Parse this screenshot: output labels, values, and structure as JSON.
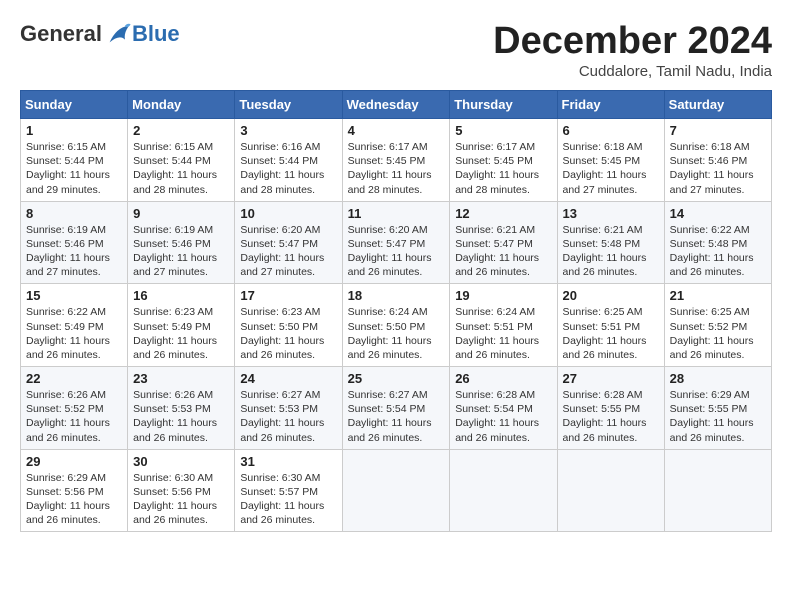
{
  "header": {
    "logo_general": "General",
    "logo_blue": "Blue",
    "month_title": "December 2024",
    "location": "Cuddalore, Tamil Nadu, India"
  },
  "columns": [
    "Sunday",
    "Monday",
    "Tuesday",
    "Wednesday",
    "Thursday",
    "Friday",
    "Saturday"
  ],
  "weeks": [
    [
      {
        "day": "1",
        "sunrise": "6:15 AM",
        "sunset": "5:44 PM",
        "daylight": "11 hours and 29 minutes."
      },
      {
        "day": "2",
        "sunrise": "6:15 AM",
        "sunset": "5:44 PM",
        "daylight": "11 hours and 28 minutes."
      },
      {
        "day": "3",
        "sunrise": "6:16 AM",
        "sunset": "5:44 PM",
        "daylight": "11 hours and 28 minutes."
      },
      {
        "day": "4",
        "sunrise": "6:17 AM",
        "sunset": "5:45 PM",
        "daylight": "11 hours and 28 minutes."
      },
      {
        "day": "5",
        "sunrise": "6:17 AM",
        "sunset": "5:45 PM",
        "daylight": "11 hours and 28 minutes."
      },
      {
        "day": "6",
        "sunrise": "6:18 AM",
        "sunset": "5:45 PM",
        "daylight": "11 hours and 27 minutes."
      },
      {
        "day": "7",
        "sunrise": "6:18 AM",
        "sunset": "5:46 PM",
        "daylight": "11 hours and 27 minutes."
      }
    ],
    [
      {
        "day": "8",
        "sunrise": "6:19 AM",
        "sunset": "5:46 PM",
        "daylight": "11 hours and 27 minutes."
      },
      {
        "day": "9",
        "sunrise": "6:19 AM",
        "sunset": "5:46 PM",
        "daylight": "11 hours and 27 minutes."
      },
      {
        "day": "10",
        "sunrise": "6:20 AM",
        "sunset": "5:47 PM",
        "daylight": "11 hours and 27 minutes."
      },
      {
        "day": "11",
        "sunrise": "6:20 AM",
        "sunset": "5:47 PM",
        "daylight": "11 hours and 26 minutes."
      },
      {
        "day": "12",
        "sunrise": "6:21 AM",
        "sunset": "5:47 PM",
        "daylight": "11 hours and 26 minutes."
      },
      {
        "day": "13",
        "sunrise": "6:21 AM",
        "sunset": "5:48 PM",
        "daylight": "11 hours and 26 minutes."
      },
      {
        "day": "14",
        "sunrise": "6:22 AM",
        "sunset": "5:48 PM",
        "daylight": "11 hours and 26 minutes."
      }
    ],
    [
      {
        "day": "15",
        "sunrise": "6:22 AM",
        "sunset": "5:49 PM",
        "daylight": "11 hours and 26 minutes."
      },
      {
        "day": "16",
        "sunrise": "6:23 AM",
        "sunset": "5:49 PM",
        "daylight": "11 hours and 26 minutes."
      },
      {
        "day": "17",
        "sunrise": "6:23 AM",
        "sunset": "5:50 PM",
        "daylight": "11 hours and 26 minutes."
      },
      {
        "day": "18",
        "sunrise": "6:24 AM",
        "sunset": "5:50 PM",
        "daylight": "11 hours and 26 minutes."
      },
      {
        "day": "19",
        "sunrise": "6:24 AM",
        "sunset": "5:51 PM",
        "daylight": "11 hours and 26 minutes."
      },
      {
        "day": "20",
        "sunrise": "6:25 AM",
        "sunset": "5:51 PM",
        "daylight": "11 hours and 26 minutes."
      },
      {
        "day": "21",
        "sunrise": "6:25 AM",
        "sunset": "5:52 PM",
        "daylight": "11 hours and 26 minutes."
      }
    ],
    [
      {
        "day": "22",
        "sunrise": "6:26 AM",
        "sunset": "5:52 PM",
        "daylight": "11 hours and 26 minutes."
      },
      {
        "day": "23",
        "sunrise": "6:26 AM",
        "sunset": "5:53 PM",
        "daylight": "11 hours and 26 minutes."
      },
      {
        "day": "24",
        "sunrise": "6:27 AM",
        "sunset": "5:53 PM",
        "daylight": "11 hours and 26 minutes."
      },
      {
        "day": "25",
        "sunrise": "6:27 AM",
        "sunset": "5:54 PM",
        "daylight": "11 hours and 26 minutes."
      },
      {
        "day": "26",
        "sunrise": "6:28 AM",
        "sunset": "5:54 PM",
        "daylight": "11 hours and 26 minutes."
      },
      {
        "day": "27",
        "sunrise": "6:28 AM",
        "sunset": "5:55 PM",
        "daylight": "11 hours and 26 minutes."
      },
      {
        "day": "28",
        "sunrise": "6:29 AM",
        "sunset": "5:55 PM",
        "daylight": "11 hours and 26 minutes."
      }
    ],
    [
      {
        "day": "29",
        "sunrise": "6:29 AM",
        "sunset": "5:56 PM",
        "daylight": "11 hours and 26 minutes."
      },
      {
        "day": "30",
        "sunrise": "6:30 AM",
        "sunset": "5:56 PM",
        "daylight": "11 hours and 26 minutes."
      },
      {
        "day": "31",
        "sunrise": "6:30 AM",
        "sunset": "5:57 PM",
        "daylight": "11 hours and 26 minutes."
      },
      null,
      null,
      null,
      null
    ]
  ]
}
